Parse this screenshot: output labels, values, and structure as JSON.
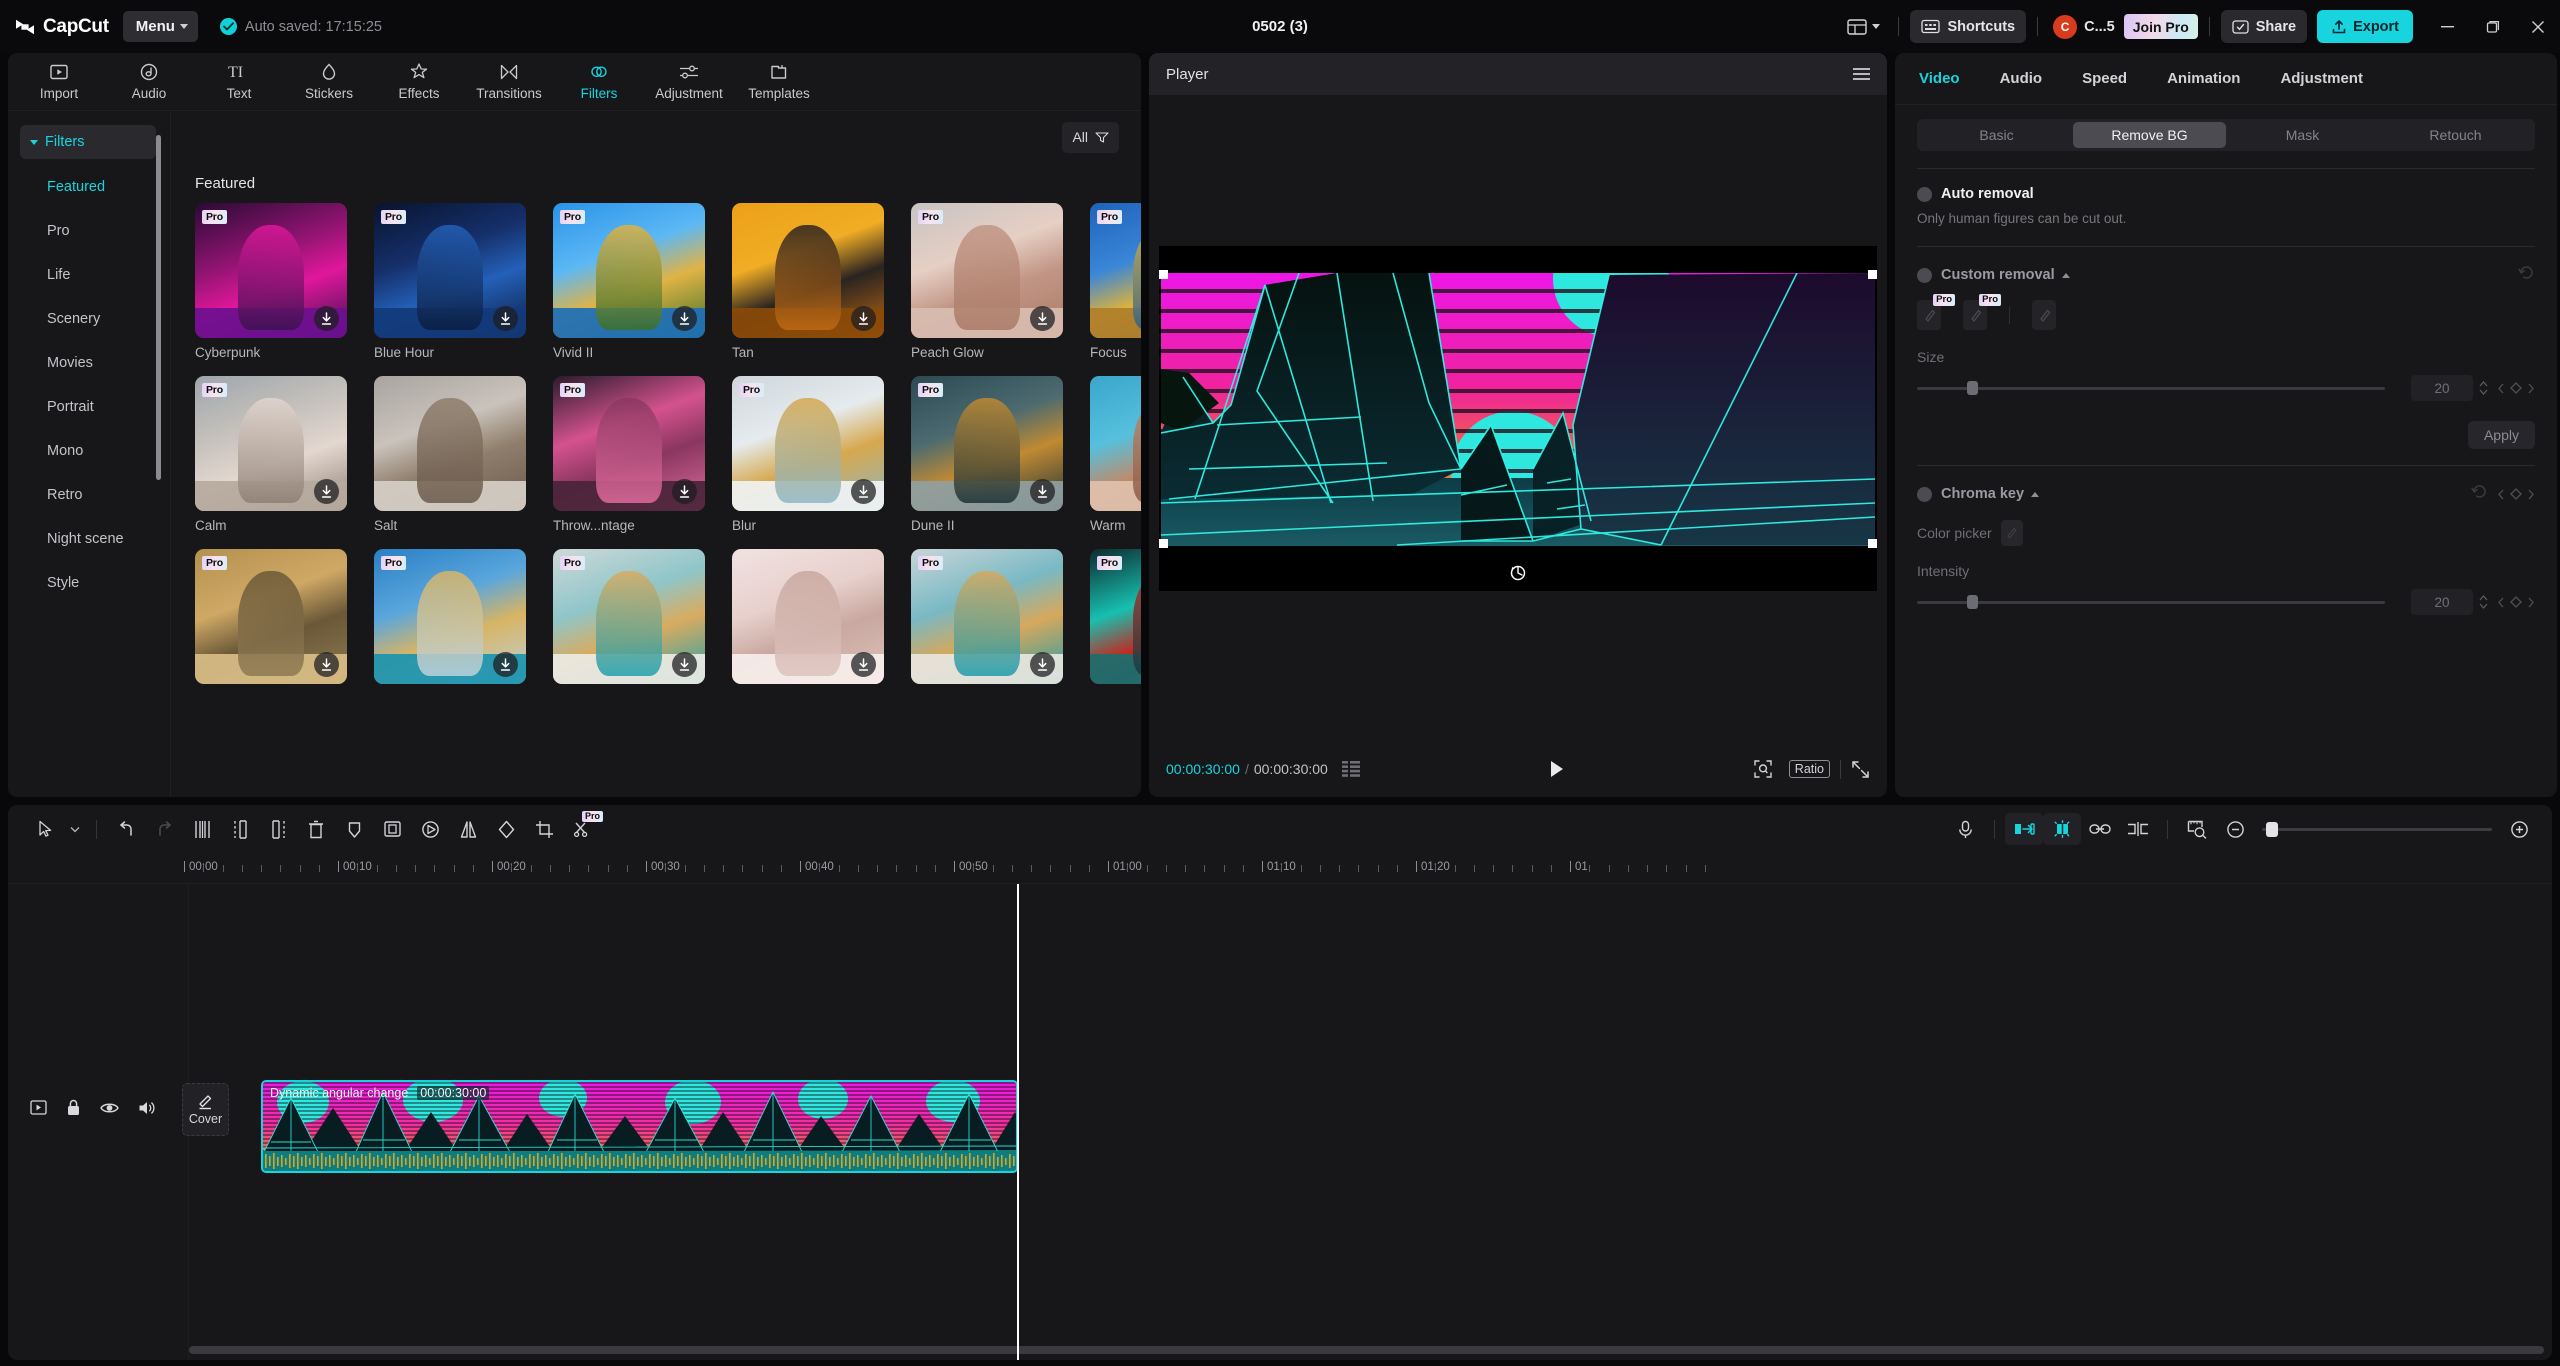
{
  "app": {
    "brand": "CapCut",
    "menu_label": "Menu",
    "autosave_text": "Auto saved: 17:15:25",
    "project_title": "0502 (3)",
    "layout_icon": "layout-icon",
    "shortcuts_label": "Shortcuts",
    "account_initial": "C",
    "account_name": "C...5",
    "join_pro_label": "Join Pro",
    "share_label": "Share",
    "export_label": "Export",
    "window_minimize": "minimize-icon",
    "window_maximize": "maximize-icon",
    "window_close": "close-icon",
    "accent": "#17d4de"
  },
  "library": {
    "tabs": [
      {
        "label": "Import",
        "icon": "import-icon",
        "active": false
      },
      {
        "label": "Audio",
        "icon": "audio-icon",
        "active": false
      },
      {
        "label": "Text",
        "icon": "text-icon",
        "active": false
      },
      {
        "label": "Stickers",
        "icon": "stickers-icon",
        "active": false
      },
      {
        "label": "Effects",
        "icon": "effects-icon",
        "active": false
      },
      {
        "label": "Transitions",
        "icon": "transitions-icon",
        "active": false
      },
      {
        "label": "Filters",
        "icon": "filters-icon",
        "active": true
      },
      {
        "label": "Adjustment",
        "icon": "adjustment-icon",
        "active": false
      },
      {
        "label": "Templates",
        "icon": "templates-icon",
        "active": false
      }
    ],
    "category_header": "Filters",
    "categories": [
      {
        "label": "Featured",
        "active": true
      },
      {
        "label": "Pro",
        "active": false
      },
      {
        "label": "Life",
        "active": false
      },
      {
        "label": "Scenery",
        "active": false
      },
      {
        "label": "Movies",
        "active": false
      },
      {
        "label": "Portrait",
        "active": false
      },
      {
        "label": "Mono",
        "active": false
      },
      {
        "label": "Retro",
        "active": false
      },
      {
        "label": "Night scene",
        "active": false
      },
      {
        "label": "Style",
        "active": false
      }
    ],
    "filter_button_label": "All",
    "section_title": "Featured",
    "filters": [
      {
        "name": "Cyberpunk",
        "pro": true,
        "download": true,
        "theme": "cyberpunk"
      },
      {
        "name": "Blue Hour",
        "pro": true,
        "download": true,
        "theme": "bluehour"
      },
      {
        "name": "Vivid II",
        "pro": true,
        "download": true,
        "theme": "vivid"
      },
      {
        "name": "Tan",
        "pro": false,
        "download": true,
        "theme": "tan"
      },
      {
        "name": "Peach Glow",
        "pro": true,
        "download": true,
        "theme": "peach"
      },
      {
        "name": "Focus",
        "pro": true,
        "download": true,
        "theme": "focus"
      },
      {
        "name": "Calm",
        "pro": true,
        "download": true,
        "theme": "calm"
      },
      {
        "name": "Salt",
        "pro": false,
        "download": false,
        "theme": "salt"
      },
      {
        "name": "Throw...ntage",
        "pro": true,
        "download": true,
        "theme": "throwback"
      },
      {
        "name": "Blur",
        "pro": true,
        "download": true,
        "theme": "blur"
      },
      {
        "name": "Dune II",
        "pro": true,
        "download": true,
        "theme": "dune"
      },
      {
        "name": "Warm",
        "pro": false,
        "download": true,
        "theme": "warm"
      },
      {
        "name": "",
        "pro": true,
        "download": true,
        "theme": "desert"
      },
      {
        "name": "",
        "pro": true,
        "download": true,
        "theme": "beach1"
      },
      {
        "name": "",
        "pro": true,
        "download": true,
        "theme": "beach2"
      },
      {
        "name": "",
        "pro": false,
        "download": true,
        "theme": "soft"
      },
      {
        "name": "",
        "pro": true,
        "download": true,
        "theme": "beach3"
      },
      {
        "name": "",
        "pro": true,
        "download": true,
        "theme": "city"
      }
    ]
  },
  "player": {
    "title": "Player",
    "menu_icon": "hamburger-icon",
    "current_time": "00:00:30:00",
    "total_time": "00:00:30:00",
    "time_separator": "/",
    "list_icon": "frames-icon",
    "play_icon": "play-icon",
    "zoom_icon": "zoom-fit-icon",
    "ratio_label": "Ratio",
    "fullscreen_icon": "fullscreen-icon",
    "rotate_icon": "rotate-icon"
  },
  "properties": {
    "tabs": [
      {
        "label": "Video",
        "active": true
      },
      {
        "label": "Audio",
        "active": false
      },
      {
        "label": "Speed",
        "active": false
      },
      {
        "label": "Animation",
        "active": false
      },
      {
        "label": "Adjustment",
        "active": false
      }
    ],
    "segments": [
      {
        "label": "Basic",
        "active": false
      },
      {
        "label": "Remove BG",
        "active": true
      },
      {
        "label": "Mask",
        "active": false
      },
      {
        "label": "Retouch",
        "active": false
      }
    ],
    "auto_removal": {
      "title": "Auto removal",
      "hint": "Only human figures can be cut out.",
      "enabled": false
    },
    "custom_removal": {
      "title": "Custom removal",
      "enabled": false,
      "tools": [
        {
          "name": "brush-tool",
          "pro": true
        },
        {
          "name": "eraser-tool",
          "pro": true
        },
        {
          "name": "quick-eraser-tool",
          "pro": false
        }
      ],
      "size_label": "Size",
      "size_value": "20",
      "apply_label": "Apply",
      "reset_icon": "reset-icon"
    },
    "chroma_key": {
      "title": "Chroma key",
      "enabled": false,
      "color_picker_label": "Color picker",
      "intensity_label": "Intensity",
      "intensity_value": "20",
      "reset_icon": "reset-icon"
    }
  },
  "timeline": {
    "tools_left": [
      {
        "name": "select-tool-icon",
        "state": "normal"
      },
      {
        "name": "chevron-down-icon",
        "state": "normal"
      },
      {
        "name": "undo-icon",
        "state": "normal"
      },
      {
        "name": "redo-icon",
        "state": "disabled"
      },
      {
        "name": "split-icon",
        "state": "normal"
      },
      {
        "name": "trim-left-icon",
        "state": "normal"
      },
      {
        "name": "trim-right-icon",
        "state": "normal"
      },
      {
        "name": "delete-icon",
        "state": "normal"
      },
      {
        "name": "marker-icon",
        "state": "normal"
      },
      {
        "name": "freeze-frame-icon",
        "state": "normal"
      },
      {
        "name": "reverse-icon",
        "state": "normal"
      },
      {
        "name": "mirror-icon",
        "state": "normal"
      },
      {
        "name": "rotate-icon",
        "state": "normal"
      },
      {
        "name": "crop-icon",
        "state": "normal"
      },
      {
        "name": "auto-cut-icon",
        "state": "pro"
      }
    ],
    "tools_right": [
      {
        "name": "voiceover-icon",
        "state": "normal"
      },
      {
        "name": "auto-fill-icon",
        "state": "active"
      },
      {
        "name": "smart-snap-icon",
        "state": "active"
      },
      {
        "name": "link-icon",
        "state": "normal"
      },
      {
        "name": "split-clip-icon",
        "state": "normal"
      },
      {
        "name": "fit-timeline-icon",
        "state": "normal"
      },
      {
        "name": "zoom-out-icon",
        "state": "normal"
      },
      {
        "name": "zoom-in-icon",
        "state": "normal"
      }
    ],
    "ruler_labels": [
      "00:00",
      "00:10",
      "00:20",
      "00:30",
      "00:40",
      "00:50",
      "01:00",
      "01:10",
      "01:20",
      "01"
    ],
    "playhead_time": "00:00:30:00",
    "track_controls": [
      {
        "name": "track-thumbnail-icon"
      },
      {
        "name": "lock-icon"
      },
      {
        "name": "eye-icon"
      },
      {
        "name": "volume-icon"
      }
    ],
    "cover_label": "Cover",
    "cover_icon": "pencil-icon",
    "clip": {
      "name": "Dynamic angular change",
      "duration": "00:00:30:00",
      "selected": true
    }
  }
}
